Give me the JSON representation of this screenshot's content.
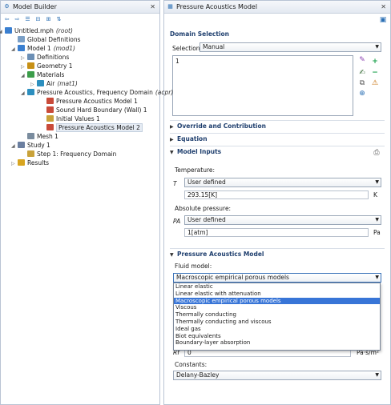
{
  "model_builder": {
    "title": "Model Builder",
    "tree": [
      {
        "label": "Untitled.mph",
        "note": "(root)"
      },
      {
        "label": "Global Definitions",
        "note": ""
      },
      {
        "label": "Model 1",
        "note": "(mod1)"
      },
      {
        "label": "Definitions",
        "note": ""
      },
      {
        "label": "Geometry 1",
        "note": ""
      },
      {
        "label": "Materials",
        "note": ""
      },
      {
        "label": "Air",
        "note": "(mat1)"
      },
      {
        "label": "Pressure Acoustics, Frequency Domain",
        "note": "(acpr)"
      },
      {
        "label": "Pressure Acoustics Model 1",
        "note": ""
      },
      {
        "label": "Sound Hard Boundary (Wall) 1",
        "note": ""
      },
      {
        "label": "Initial Values 1",
        "note": ""
      },
      {
        "label": "Pressure Acoustics Model 2",
        "note": ""
      },
      {
        "label": "Mesh 1",
        "note": ""
      },
      {
        "label": "Study 1",
        "note": ""
      },
      {
        "label": "Step 1: Frequency Domain",
        "note": ""
      },
      {
        "label": "Results",
        "note": ""
      }
    ]
  },
  "settings": {
    "title": "Pressure Acoustics Model",
    "domain_selection": {
      "header": "Domain Selection",
      "selection_label": "Selection:",
      "selection_value": "Manual",
      "list_value": "1"
    },
    "override_header": "Override and Contribution",
    "equation_header": "Equation",
    "model_inputs": {
      "header": "Model Inputs",
      "temperature_label": "Temperature:",
      "temperature_symbol": "T",
      "temperature_source": "User defined",
      "temperature_value": "293.15[K]",
      "temperature_unit": "K",
      "pressure_label": "Absolute pressure:",
      "pressure_symbol": "PA",
      "pressure_source": "User defined",
      "pressure_value": "1[atm]",
      "pressure_unit": "Pa"
    },
    "pressure_acoustics_model": {
      "header": "Pressure Acoustics Model",
      "fluid_model_label": "Fluid model:",
      "fluid_model_value": "Macroscopic empirical porous models",
      "options": [
        "Linear elastic",
        "Linear elastic with attenuation",
        "Macroscopic empirical porous models",
        "Viscous",
        "Thermally conducting",
        "Thermally conducting and viscous",
        "Ideal gas",
        "Biot equivalents",
        "Boundary-layer absorption"
      ],
      "selected_option": 2,
      "rf_symbol": "Rf",
      "rf_value": "0",
      "rf_unit": "Pa·s/m²",
      "constants_label": "Constants:",
      "constants_value": "Delany-Bazley"
    }
  },
  "colors": {
    "section_header": "#1f3f6e",
    "selection_highlight": "#3875d7",
    "border": "#b9c4d4"
  }
}
